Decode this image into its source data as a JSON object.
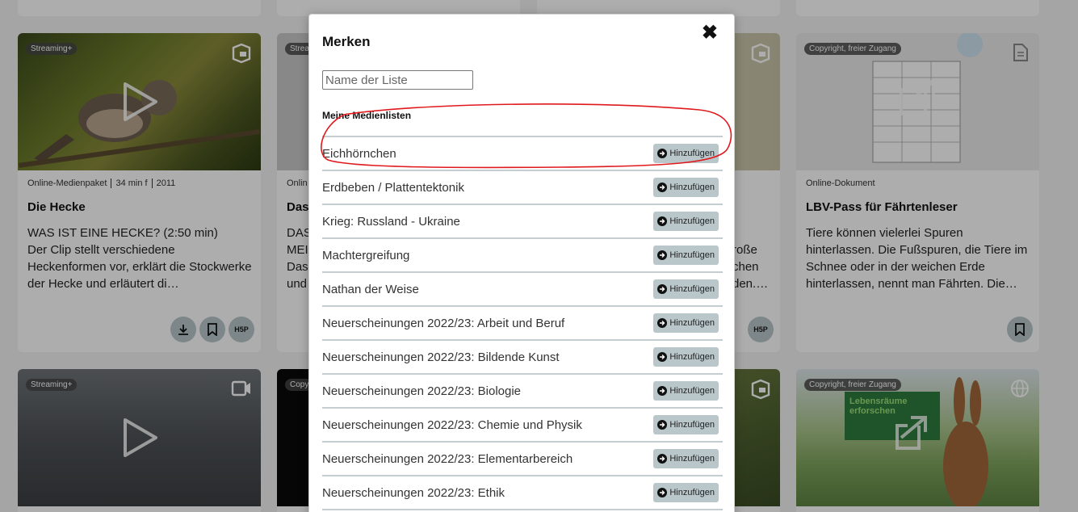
{
  "cards": [
    {
      "badge": "Streaming+",
      "type_icon": "package-icon",
      "meta": [
        "Online-Medienpaket",
        "34 min f",
        "2011"
      ],
      "title": "Die Hecke",
      "description": "WAS IST EINE HECKE? (2:50 min)\nDer Clip stellt verschiedene Heckenformen vor, erklärt die Stockwerke der Hecke und erläutert di…",
      "actions": [
        "download-icon",
        "bookmark-icon",
        "H5P"
      ]
    },
    {
      "badge": "Copyright, freier Zugang",
      "type_icon": "document-icon",
      "meta": [
        "Online-Dokument"
      ],
      "title": "LBV-Pass für Fährtenleser",
      "description": "Tiere können vielerlei Spuren hinterlassen. Die Fußspuren, die Tiere im Schnee oder in der weichen Erde hinterlassen, nennt man Fährten. Die…",
      "actions": [
        "bookmark-icon"
      ]
    },
    {
      "badge": "Streaming+",
      "type_icon": "video-icon"
    },
    {
      "badge": "Copyright, freier Zugang",
      "type_icon": "globe-icon",
      "thumb_text": "Lebensräume erforschen"
    }
  ],
  "partial_texts": {
    "card2_meta": "Onlin",
    "card2_title": "Das",
    "card2_desc": [
      "DAS",
      "MEI",
      "Das",
      "und"
    ],
    "card3_desc": [
      "roße",
      "chen",
      "den.…"
    ],
    "card3_action": "H5P",
    "card4_badge": "Copy",
    "card2_badge": "Strea",
    "card3_badge": ""
  },
  "modal": {
    "title": "Merken",
    "close_label": "✖",
    "name_placeholder": "Name der Liste",
    "name_value": "",
    "section_label": "Meine Medienlisten",
    "add_label": "Hinzufügen",
    "lists": [
      "Eichhörnchen",
      "Erdbeben / Plattentektonik",
      "Krieg: Russland - Ukraine",
      "Machtergreifung",
      "Nathan der Weise",
      "Neuerscheinungen 2022/23: Arbeit und Beruf",
      "Neuerscheinungen 2022/23: Bildende Kunst",
      "Neuerscheinungen 2022/23: Biologie",
      "Neuerscheinungen 2022/23: Chemie und Physik",
      "Neuerscheinungen 2022/23: Elementarbereich",
      "Neuerscheinungen 2022/23: Ethik"
    ]
  },
  "colors": {
    "action_bg": "#b8c6cb",
    "annotation": "#e0191d",
    "overlay": "rgba(0,0,0,0.32)"
  }
}
